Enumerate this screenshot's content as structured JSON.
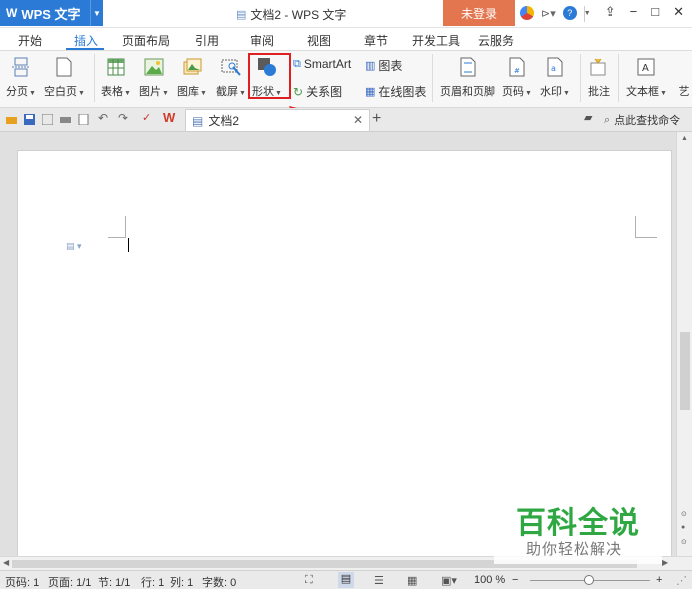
{
  "window": {
    "app_name": "WPS 文字",
    "doc_title": "文档2 - WPS 文字",
    "login_label": "未登录"
  },
  "menu": {
    "tabs": [
      "开始",
      "插入",
      "页面布局",
      "引用",
      "审阅",
      "视图",
      "章节",
      "开发工具",
      "云服务"
    ],
    "active": "插入"
  },
  "ribbon": {
    "page_break": "分页",
    "blank_page": "空白页",
    "table": "表格",
    "picture": "图片",
    "gallery": "图库",
    "screenshot": "截屏",
    "shape": "形状",
    "smartart": "SmartArt",
    "chart": "图表",
    "relation": "关系图",
    "online_chart": "在线图表",
    "header_footer": "页眉和页脚",
    "page_number": "页码",
    "watermark": "水印",
    "comment": "批注",
    "textbox": "文本框",
    "art": "艺"
  },
  "tabs_bar": {
    "doc_tab": "文档2",
    "find_command": "点此查找命令"
  },
  "watermark": {
    "title": "百科全说",
    "subtitle": "助你轻松解决"
  },
  "status": {
    "page_num": "页码: 1",
    "pages": "页面: 1/1",
    "section": "节: 1/1",
    "row": "行: 1",
    "col": "列: 1",
    "chars": "字数: 0",
    "zoom": "100 %"
  },
  "colors": {
    "accent": "#2b7bd6",
    "login_bg": "#e4764f",
    "highlight": "#e02020",
    "watermark_green": "#2fa843"
  }
}
